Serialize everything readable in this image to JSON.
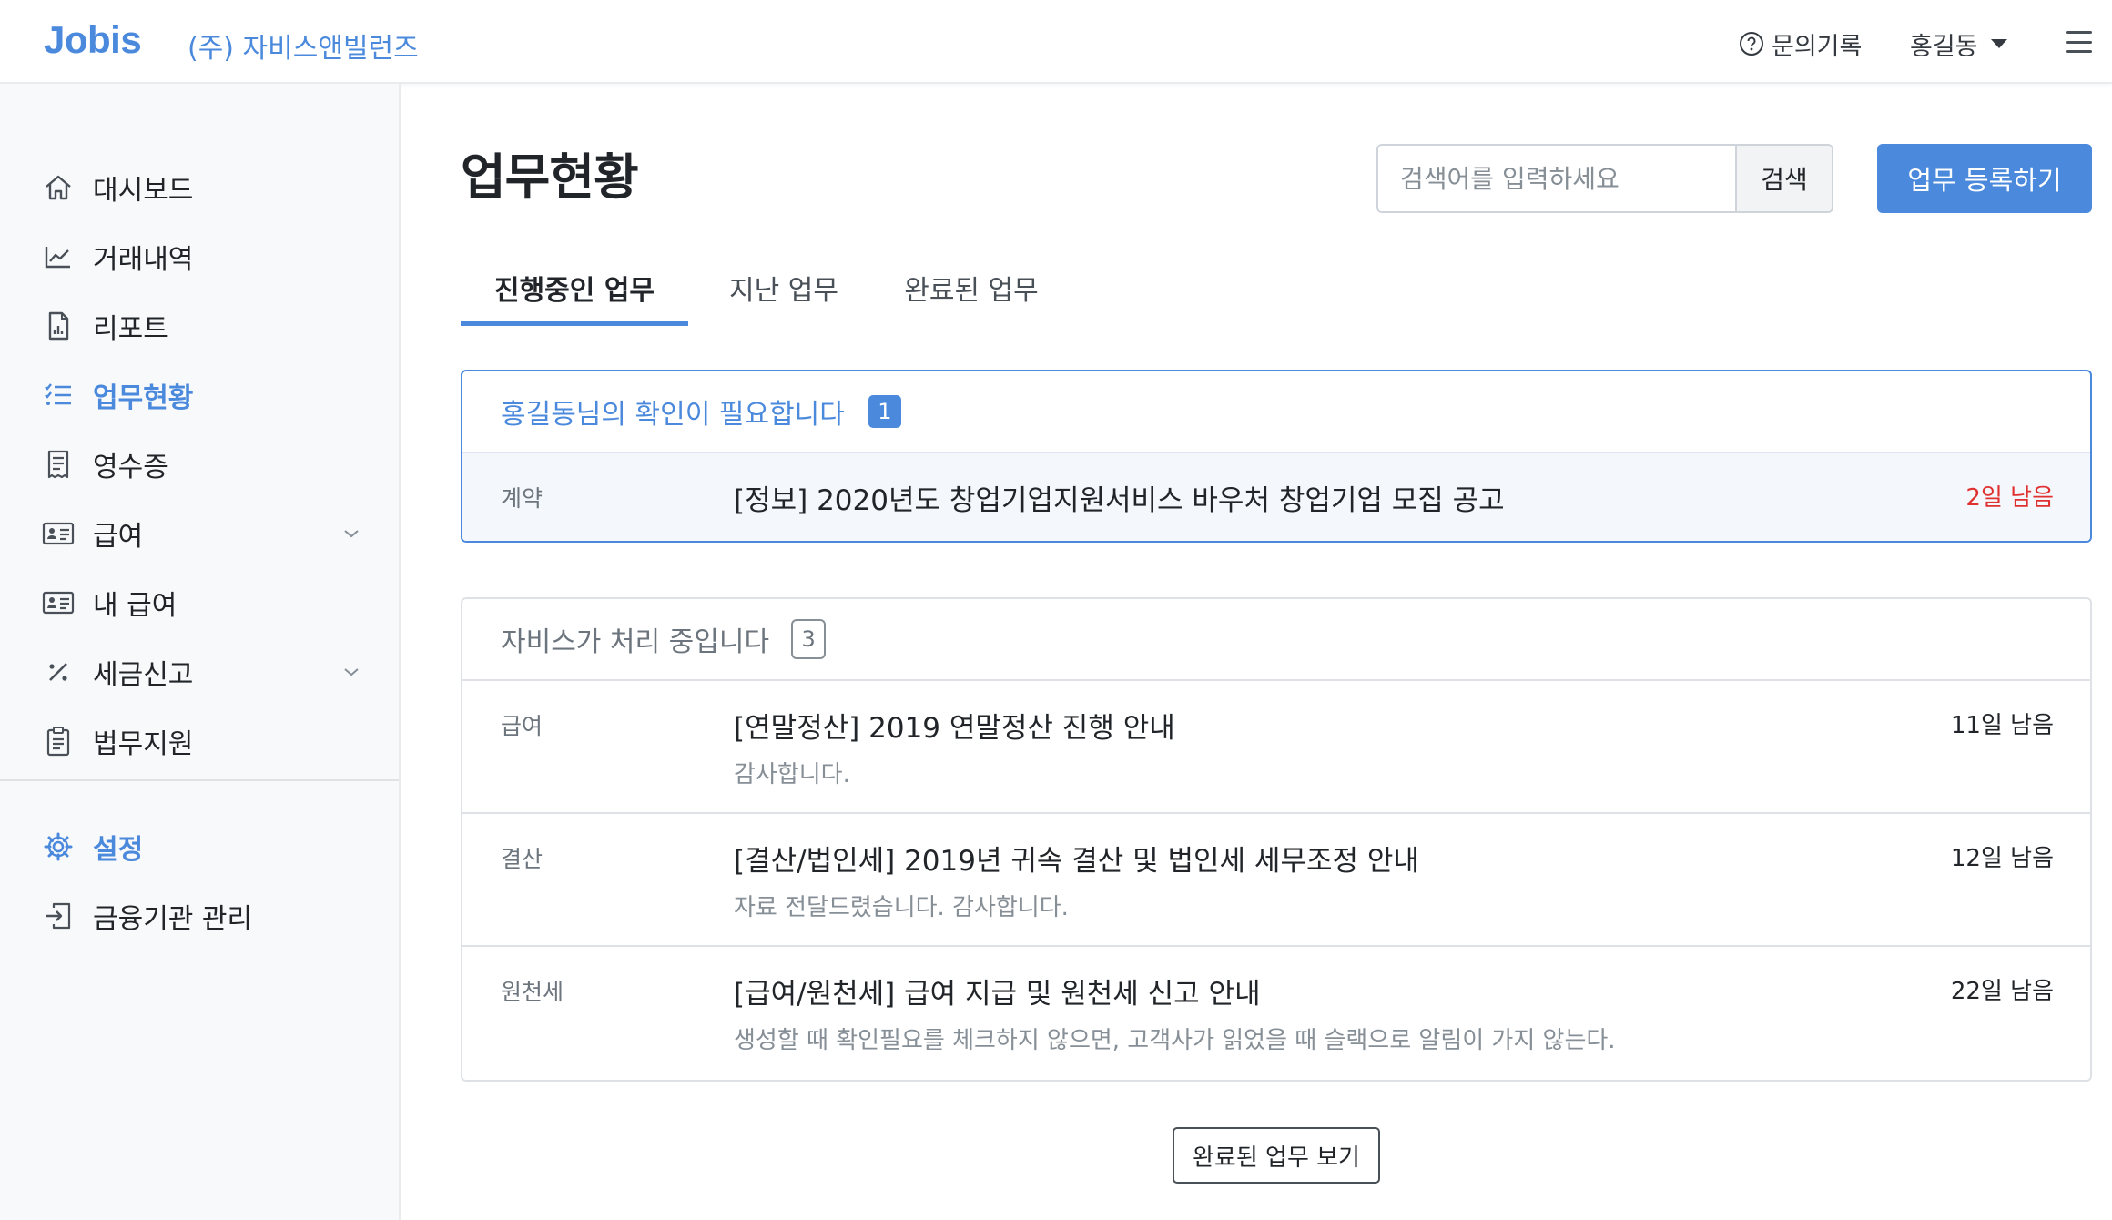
{
  "header": {
    "logo": "Jobis",
    "company": "(주) 자비스앤빌런즈",
    "inquiry_label": "문의기록",
    "user_name": "홍길동"
  },
  "sidebar": {
    "items": [
      {
        "label": "대시보드",
        "icon": "home-icon"
      },
      {
        "label": "거래내역",
        "icon": "chart-line-icon"
      },
      {
        "label": "리포트",
        "icon": "report-document-icon"
      },
      {
        "label": "업무현황",
        "icon": "list-check-icon",
        "active": true
      },
      {
        "label": "영수증",
        "icon": "receipt-icon"
      },
      {
        "label": "급여",
        "icon": "id-card-icon",
        "expandable": true
      },
      {
        "label": "내 급여",
        "icon": "id-card-icon"
      },
      {
        "label": "세금신고",
        "icon": "percent-icon",
        "expandable": true
      },
      {
        "label": "법무지원",
        "icon": "clipboard-icon"
      }
    ],
    "bottom_items": [
      {
        "label": "설정",
        "icon": "gear-icon",
        "active": true
      },
      {
        "label": "금융기관 관리",
        "icon": "bank-login-icon"
      }
    ]
  },
  "main": {
    "title": "업무현황",
    "search": {
      "placeholder": "검색어를 입력하세요",
      "button": "검색"
    },
    "register_button": "업무 등록하기",
    "tabs": [
      {
        "label": "진행중인 업무",
        "active": true
      },
      {
        "label": "지난 업무"
      },
      {
        "label": "완료된 업무"
      }
    ],
    "confirm_section": {
      "title": "홍길동님의 확인이 필요합니다",
      "count": "1",
      "rows": [
        {
          "category": "계약",
          "title": "[정보] 2020년도 창업기업지원서비스 바우처 창업기업 모집 공고",
          "due": "2일 남음"
        }
      ]
    },
    "processing_section": {
      "title": "자비스가 처리 중입니다",
      "count": "3",
      "rows": [
        {
          "category": "급여",
          "title": "[연말정산] 2019 연말정산 진행 안내",
          "desc": "감사합니다.",
          "due": "11일 남음"
        },
        {
          "category": "결산",
          "title": "[결산/법인세] 2019년 귀속 결산 및 법인세 세무조정 안내",
          "desc": "자료 전달드렸습니다. 감사합니다.",
          "due": "12일 남음"
        },
        {
          "category": "원천세",
          "title": "[급여/원천세] 급여 지급 및 원천세 신고 안내",
          "desc": "생성할 때 확인필요를 체크하지 않으면, 고객사가 읽었을 때 슬랙으로 알림이 가지 않는다.",
          "due": "22일 남음"
        }
      ]
    },
    "view_completed_button": "완료된 업무 보기"
  },
  "colors": {
    "brand": "#4a89dc",
    "urgent": "#e03131",
    "sidebar_bg": "#f8f9fa"
  }
}
